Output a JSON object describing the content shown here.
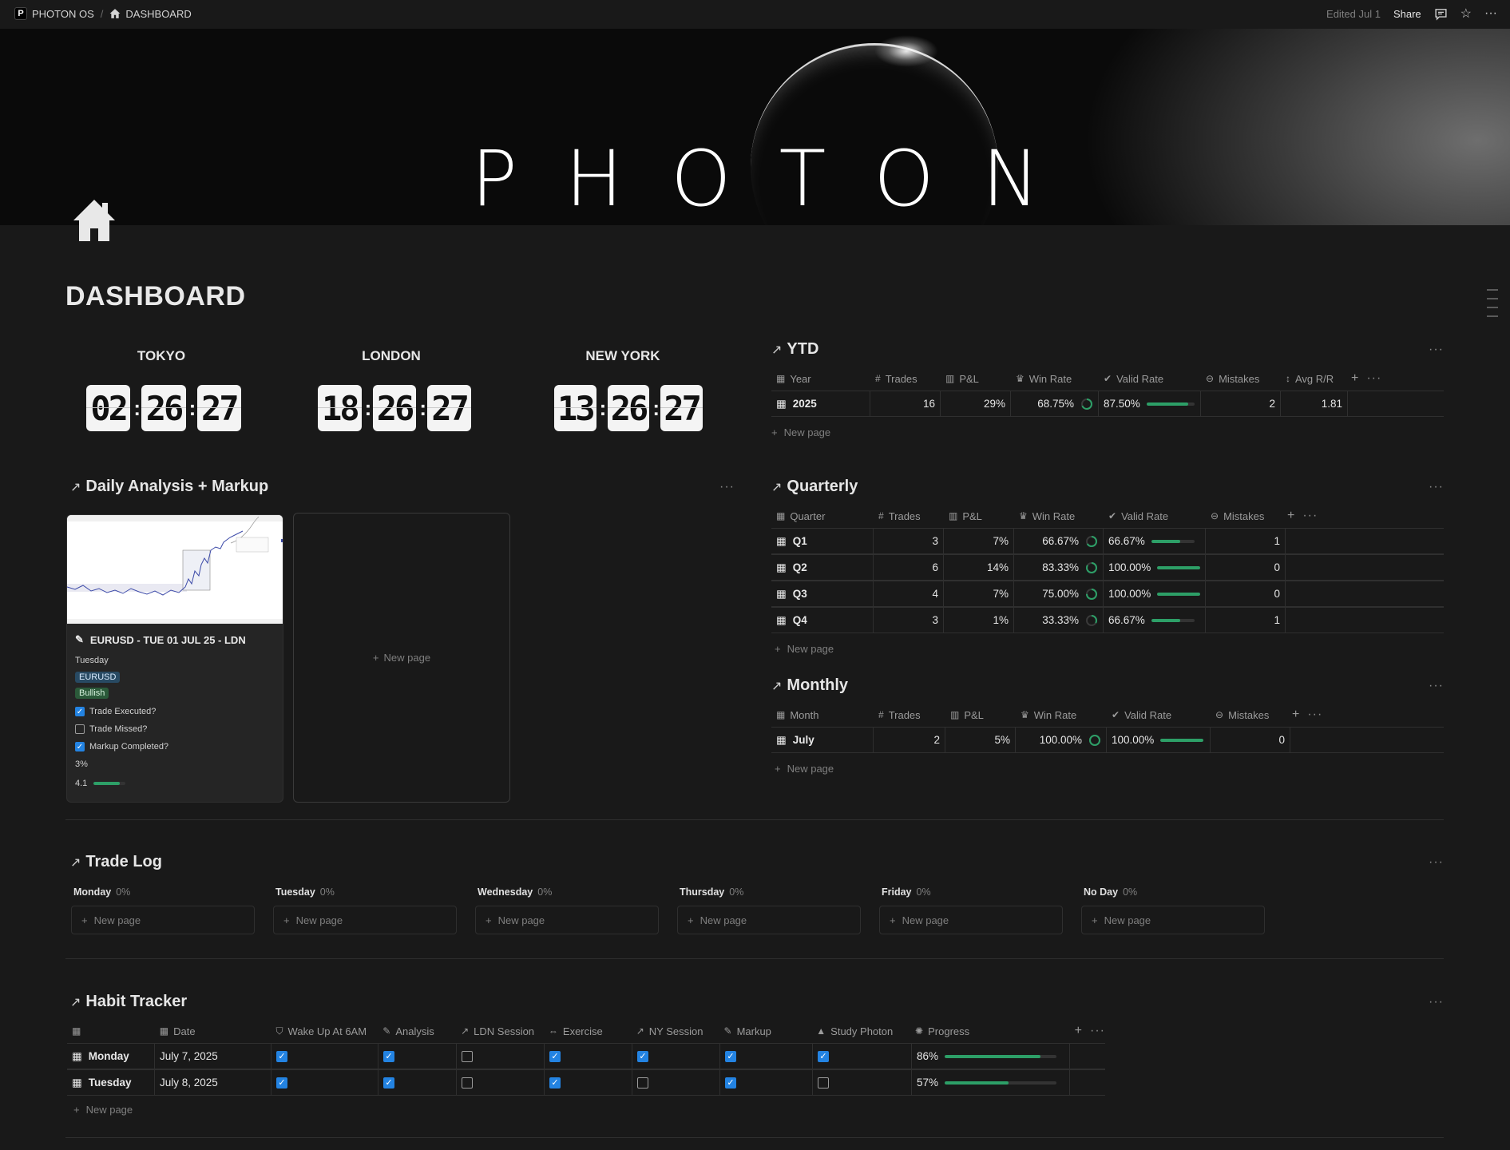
{
  "topbar": {
    "workspace": "PHOTON OS",
    "page": "DASHBOARD",
    "edited": "Edited Jul 1",
    "share": "Share"
  },
  "cover": {
    "title": "PHOTON"
  },
  "page_title": "DASHBOARD",
  "clocks": [
    {
      "city": "TOKYO",
      "h": "02",
      "m": "26",
      "s": "27"
    },
    {
      "city": "LONDON",
      "h": "18",
      "m": "26",
      "s": "27"
    },
    {
      "city": "NEW YORK",
      "h": "13",
      "m": "26",
      "s": "27"
    }
  ],
  "ytd": {
    "title": "YTD",
    "columns": [
      "Year",
      "Trades",
      "P&L",
      "Win Rate",
      "Valid Rate",
      "Mistakes",
      "Avg R/R"
    ],
    "rows": [
      {
        "label": "2025",
        "trades": "16",
        "pnl": "29%",
        "win": "68.75%",
        "win_frac": 0.6875,
        "valid": "87.50%",
        "valid_frac": 0.875,
        "mistakes": "2",
        "rr": "1.81"
      }
    ],
    "new_page": "New page"
  },
  "quarterly": {
    "title": "Quarterly",
    "columns": [
      "Quarter",
      "Trades",
      "P&L",
      "Win Rate",
      "Valid Rate",
      "Mistakes"
    ],
    "rows": [
      {
        "label": "Q1",
        "trades": "3",
        "pnl": "7%",
        "win": "66.67%",
        "win_frac": 0.6667,
        "valid": "66.67%",
        "valid_frac": 0.6667,
        "mistakes": "1"
      },
      {
        "label": "Q2",
        "trades": "6",
        "pnl": "14%",
        "win": "83.33%",
        "win_frac": 0.8333,
        "valid": "100.00%",
        "valid_frac": 1.0,
        "mistakes": "0"
      },
      {
        "label": "Q3",
        "trades": "4",
        "pnl": "7%",
        "win": "75.00%",
        "win_frac": 0.75,
        "valid": "100.00%",
        "valid_frac": 1.0,
        "mistakes": "0"
      },
      {
        "label": "Q4",
        "trades": "3",
        "pnl": "1%",
        "win": "33.33%",
        "win_frac": 0.3333,
        "valid": "66.67%",
        "valid_frac": 0.6667,
        "mistakes": "1"
      }
    ],
    "new_page": "New page"
  },
  "monthly": {
    "title": "Monthly",
    "columns": [
      "Month",
      "Trades",
      "P&L",
      "Win Rate",
      "Valid Rate",
      "Mistakes"
    ],
    "rows": [
      {
        "label": "July",
        "trades": "2",
        "pnl": "5%",
        "win": "100.00%",
        "win_frac": 1.0,
        "valid": "100.00%",
        "valid_frac": 1.0,
        "mistakes": "0"
      }
    ],
    "new_page": "New page"
  },
  "daily": {
    "title": "Daily Analysis + Markup",
    "card": {
      "title": "EURUSD - TUE 01 JUL 25 - LDN",
      "day": "Tuesday",
      "pair": "EURUSD",
      "bias": "Bullish",
      "checks": [
        {
          "label": "Trade Executed?",
          "on": true
        },
        {
          "label": "Trade Missed?",
          "on": false
        },
        {
          "label": "Markup Completed?",
          "on": true
        }
      ],
      "pct": "3%",
      "rr": "4.1",
      "rr_frac": 0.82
    },
    "new_page": "New page"
  },
  "tradelog": {
    "title": "Trade Log",
    "columns": [
      {
        "day": "Monday",
        "pct": "0%"
      },
      {
        "day": "Tuesday",
        "pct": "0%"
      },
      {
        "day": "Wednesday",
        "pct": "0%"
      },
      {
        "day": "Thursday",
        "pct": "0%"
      },
      {
        "day": "Friday",
        "pct": "0%"
      },
      {
        "day": "No Day",
        "pct": "0%"
      }
    ],
    "new_page": "New page"
  },
  "habit": {
    "title": "Habit Tracker",
    "columns": [
      "Date",
      "Wake Up At 6AM",
      "Analysis",
      "LDN Session",
      "Exercise",
      "NY Session",
      "Markup",
      "Study Photon",
      "Progress"
    ],
    "rows": [
      {
        "day": "Monday",
        "date": "July 7, 2025",
        "checks": [
          true,
          true,
          false,
          true,
          true,
          true,
          true
        ],
        "progress": "86%",
        "progress_frac": 0.86
      },
      {
        "day": "Tuesday",
        "date": "July 8, 2025",
        "checks": [
          true,
          true,
          false,
          true,
          false,
          true,
          false
        ],
        "progress": "57%",
        "progress_frac": 0.57
      }
    ],
    "new_page": "New page"
  },
  "colors": {
    "accent_green": "#2d9f67",
    "checkbox_blue": "#2383e2",
    "pair_tag": "#284a63",
    "bias_tag": "#2b5a3a"
  }
}
